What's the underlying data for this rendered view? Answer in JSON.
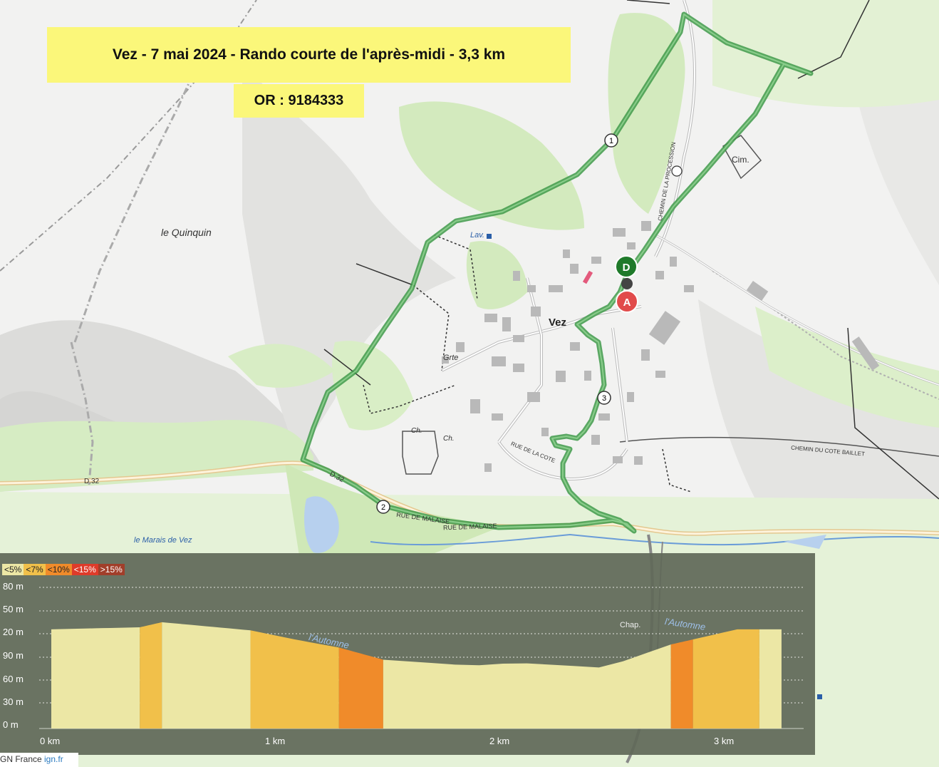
{
  "title": "Vez - 7 mai 2024 - Rando courte de l'après-midi - 3,3 km",
  "reference": "OR : 9184333",
  "map_labels": {
    "locality": "le Quinquin",
    "village": "Vez",
    "marais": "le Marais de Vez",
    "river1": "l'Automne",
    "river2": "l'Automne",
    "road_d32_a": "D.32",
    "road_d32_b": "D.32",
    "rue_malaise_a": "RUE DE MALAISE",
    "rue_malaise_b": "RUE DE MALAISE",
    "chemin_procession": "CHEMIN DE LA PROCESSION",
    "chemin_cote_baillet": "CHEMIN DU COTE BAILLET",
    "rue_cote": "RUE DE LA COTE",
    "lavoir": "Lav.",
    "cimetiere": "Cim.",
    "grotte": "Grte",
    "chapelle1": "Ch.",
    "chapelle2": "Ch.",
    "chapelle3": "Chap."
  },
  "markers": {
    "start": "D",
    "end": "A"
  },
  "waypoints": [
    "1",
    "2",
    "3"
  ],
  "colors": {
    "route": "#3f9a4a",
    "start": "#1f7a2a",
    "end": "#e14b4b",
    "forest": "#cfe8b7",
    "title_bg": "#fbf77a"
  },
  "legend": [
    {
      "label": "<5%",
      "color": "#ece7a5"
    },
    {
      "label": "<7%",
      "color": "#f1c04a"
    },
    {
      "label": "<10%",
      "color": "#f08b2a"
    },
    {
      "label": "<15%",
      "color": "#de3b2a"
    },
    {
      "label": ">15%",
      "color": "#a13e2a"
    }
  ],
  "chart_data": {
    "type": "area",
    "y_tick_labels": [
      "80 m",
      "50 m",
      "20 m",
      "90 m",
      "60 m",
      "30 m",
      "0 m"
    ],
    "x_tick_labels": [
      "0 km",
      "1 km",
      "2 km",
      "3 km"
    ],
    "xlim": [
      0,
      3.4
    ],
    "profile_relative": [
      [
        0.0,
        0.98
      ],
      [
        0.4,
        1.0
      ],
      [
        0.5,
        1.05
      ],
      [
        0.9,
        0.97
      ],
      [
        1.1,
        0.88
      ],
      [
        1.3,
        0.8
      ],
      [
        1.5,
        0.68
      ],
      [
        1.9,
        0.62
      ],
      [
        2.1,
        0.65
      ],
      [
        2.5,
        0.6
      ],
      [
        2.8,
        0.83
      ],
      [
        3.1,
        0.98
      ],
      [
        3.3,
        0.98
      ]
    ],
    "segments": [
      {
        "from": 0.0,
        "to": 0.4,
        "grade": "<5%"
      },
      {
        "from": 0.4,
        "to": 0.5,
        "grade": "<7%"
      },
      {
        "from": 0.5,
        "to": 0.9,
        "grade": "<5%"
      },
      {
        "from": 0.9,
        "to": 1.3,
        "grade": "<7%"
      },
      {
        "from": 1.3,
        "to": 1.5,
        "grade": "<10%"
      },
      {
        "from": 1.5,
        "to": 2.8,
        "grade": "<5%"
      },
      {
        "from": 2.8,
        "to": 2.9,
        "grade": "<10%"
      },
      {
        "from": 2.9,
        "to": 3.2,
        "grade": "<7%"
      },
      {
        "from": 3.2,
        "to": 3.3,
        "grade": "<5%"
      }
    ]
  },
  "credit": {
    "prefix": "GN France ",
    "link": "ign.fr"
  }
}
